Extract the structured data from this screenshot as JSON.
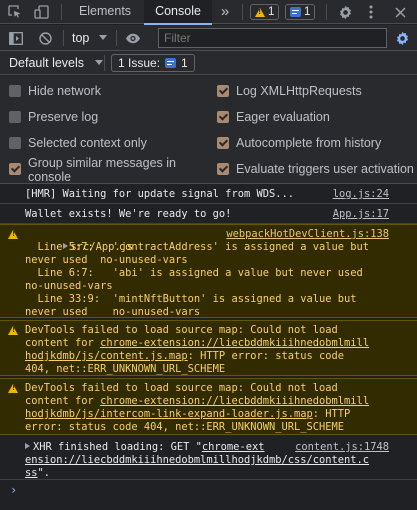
{
  "tabbar": {
    "tabs": [
      {
        "label": "Elements"
      },
      {
        "label": "Console"
      }
    ],
    "more": "»",
    "warnings_count": "1",
    "info_count": "1"
  },
  "toolbar": {
    "context": "top",
    "filter_placeholder": "Filter"
  },
  "toolbar3": {
    "levels": "Default levels",
    "issues_label": "1 Issue:",
    "issues_count": "1"
  },
  "settings": {
    "left": [
      {
        "label": "Hide network",
        "checked": false
      },
      {
        "label": "Preserve log",
        "checked": false
      },
      {
        "label": "Selected context only",
        "checked": false
      },
      {
        "label": "Group similar messages in console",
        "checked": true
      }
    ],
    "right": [
      {
        "label": "Log XMLHttpRequests",
        "checked": true
      },
      {
        "label": "Eager evaluation",
        "checked": true
      },
      {
        "label": "Autocomplete from history",
        "checked": true
      },
      {
        "label": "Evaluate triggers user activation",
        "checked": true
      }
    ]
  },
  "console": {
    "messages": [
      {
        "text": "[HMR] Waiting for update signal from WDS...",
        "source": "log.js:24"
      },
      {
        "text": "Wallet exists! We're ready to go!",
        "source": "App.js:17"
      },
      {
        "file": "src/App.js",
        "source": "webpackHotDevClient.js:138",
        "lines": [
          "  Line 5:7:   'contractAddress' is assigned a value but",
          "never used  no-unused-vars",
          "  Line 6:7:   'abi' is assigned a value but never used",
          "no-unused-vars",
          "  Line 33:9:  'mintNftButton' is assigned a value but",
          "never used    no-unused-vars"
        ]
      },
      {
        "line1": "DevTools failed to load source map: Could not load",
        "line2_pre": "content for ",
        "link": "chrome-extension://liecbddmkiiihnedobmlmill",
        "link2": "hodjkdmb/js/content.js.map",
        "line3_post": ": HTTP error: status code",
        "line4": "404, net::ERR_UNKNOWN_URL_SCHEME"
      },
      {
        "line1": "DevTools failed to load source map: Could not load",
        "line2_pre": "content for ",
        "link": "chrome-extension://liecbddmkiiihnedobmlmill",
        "link2": "hodjkdmb/js/intercom-link-expand-loader.js.map",
        "line3_post": ": HTTP",
        "line4": "error: status code 404, net::ERR_UNKNOWN_URL_SCHEME"
      },
      {
        "prefix": "XHR finished loading: GET \"",
        "link1": "chrome-ext",
        "link2": "ension://liecbddmkiiihnedobmlmillhodjkdmb/css/content.c",
        "link3": "ss",
        "suffix": "\".",
        "source": "content.js:1748"
      }
    ],
    "prompt": "›"
  },
  "colors": {
    "background": "#202124",
    "toolbar": "#292a2d",
    "warning_bg": "#332b00",
    "warning_text": "#f8d068",
    "accent": "#8ab4f8"
  }
}
